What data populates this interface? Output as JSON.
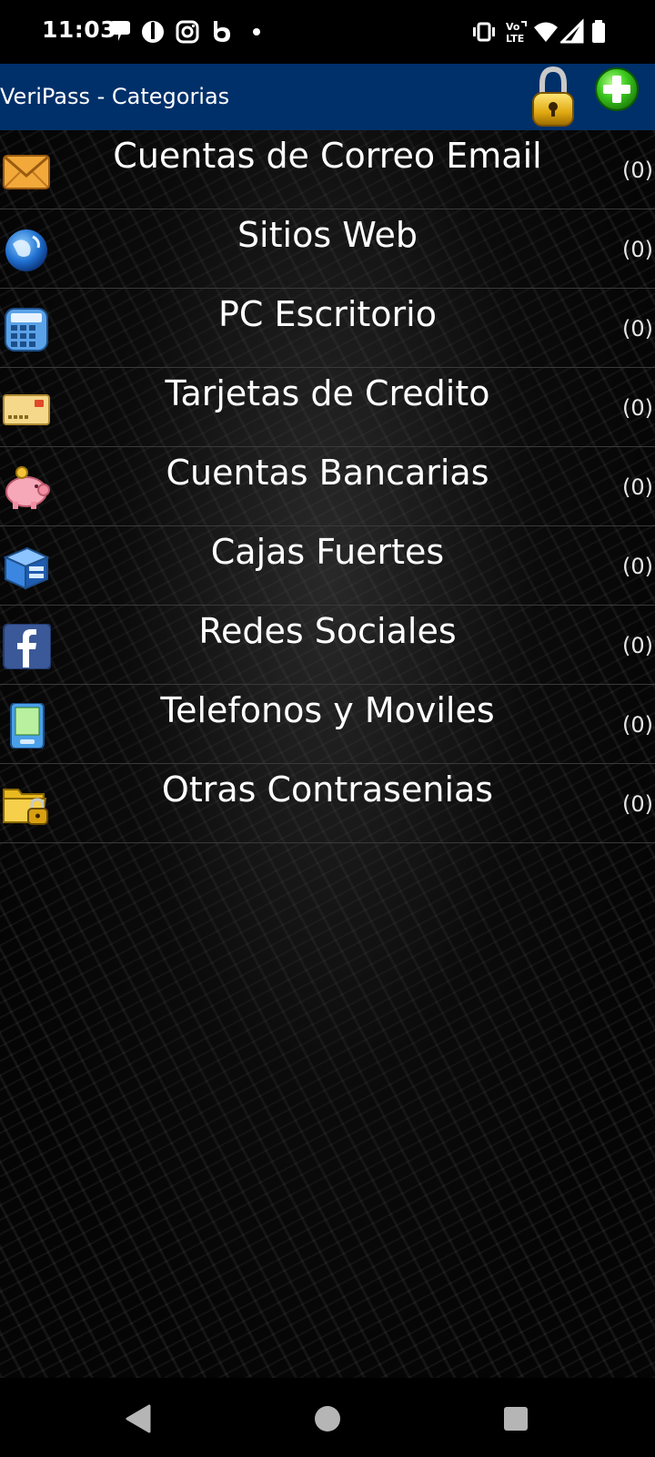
{
  "status_bar": {
    "time": "11:03",
    "left_icons": [
      "chat-bubble-icon",
      "guardian-icon",
      "instagram-icon",
      "bet-icon",
      "dot-icon"
    ],
    "right_icons": [
      "vibrate-icon",
      "volte-icon",
      "wifi-icon",
      "signal-icon",
      "battery-icon"
    ]
  },
  "app_bar": {
    "title": "VeriPass - Categorias",
    "actions": [
      "lock-icon",
      "add-icon"
    ]
  },
  "categories": [
    {
      "label": "Cuentas de Correo Email",
      "count": "(0)",
      "icon": "envelope-icon"
    },
    {
      "label": "Sitios Web",
      "count": "(0)",
      "icon": "globe-icon"
    },
    {
      "label": "PC Escritorio",
      "count": "(0)",
      "icon": "calculator-icon"
    },
    {
      "label": "Tarjetas de Credito",
      "count": "(0)",
      "icon": "credit-card-icon"
    },
    {
      "label": "Cuentas Bancarias",
      "count": "(0)",
      "icon": "piggy-bank-icon"
    },
    {
      "label": "Cajas Fuertes",
      "count": "(0)",
      "icon": "safe-box-icon"
    },
    {
      "label": "Redes Sociales",
      "count": "(0)",
      "icon": "facebook-icon"
    },
    {
      "label": "Telefonos y Moviles",
      "count": "(0)",
      "icon": "mobile-phone-icon"
    },
    {
      "label": "Otras Contrasenias",
      "count": "(0)",
      "icon": "locked-folder-icon"
    }
  ],
  "nav_bar": {
    "buttons": [
      "back-icon",
      "home-icon",
      "recents-icon"
    ]
  },
  "colors": {
    "app_bar": "#00306a",
    "background": "#000000",
    "text": "#ffffff",
    "divider": "#3a3a3a"
  }
}
